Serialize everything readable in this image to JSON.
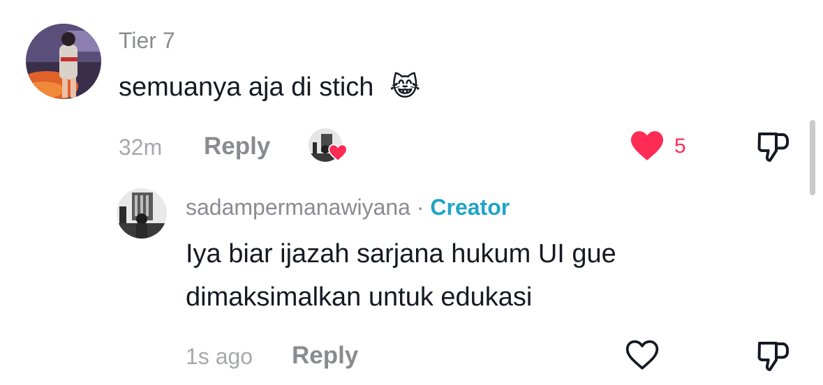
{
  "comment": {
    "username": "Tier 7",
    "text": "semuanya aja di stich",
    "emoji": "😹",
    "time": "32m",
    "reply_label": "Reply",
    "like_count": "5",
    "liked": true,
    "creator_liked": true
  },
  "reply": {
    "username": "sadampermanawiyana",
    "separator": "·",
    "badge": "Creator",
    "text_line1": "Iya biar ijazah sarjana hukum UI gue",
    "text_line2": "dimaksimalkan untuk edukasi",
    "time": "1s ago",
    "reply_label": "Reply",
    "liked": false
  },
  "colors": {
    "like_red": "#fe2c55",
    "creator_blue": "#20a4c8",
    "secondary_text": "#8a8b91"
  },
  "icons": {
    "like": "heart-icon",
    "dislike": "thumbs-down-icon",
    "creator_like": "creator-liked-avatar-icon"
  }
}
